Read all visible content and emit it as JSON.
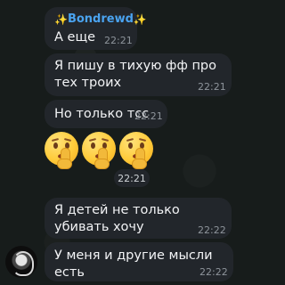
{
  "messages": [
    {
      "sender": "Bondrewd",
      "sender_decor": "✨",
      "text": "А еще",
      "time": "22:21"
    },
    {
      "text": "Я пишу в тихую фф про тех троих",
      "time": "22:21"
    },
    {
      "text": "Но только тсс",
      "time": "22:21"
    },
    {
      "emoji": "shushing-face",
      "count": 3,
      "time": "22:21"
    },
    {
      "text": "Я детей не только убивать хочу",
      "time": "22:22"
    },
    {
      "text": "У меня и другие мысли есть",
      "time": "22:22"
    }
  ],
  "colors": {
    "background": "#171c1b",
    "bubble": "#22262b",
    "sender_name": "#4aa3f0",
    "time": "#8e949b"
  }
}
